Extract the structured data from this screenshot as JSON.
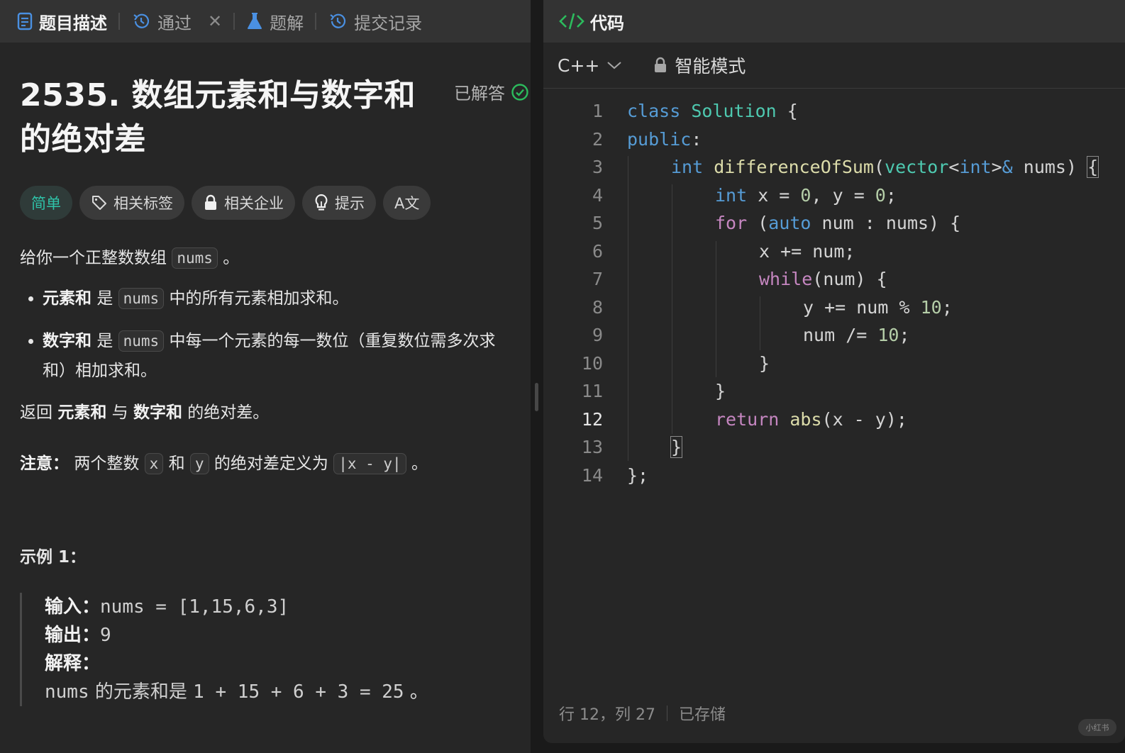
{
  "left_tabs": [
    {
      "label": "题目描述",
      "icon": "description-icon"
    },
    {
      "label": "通过",
      "icon": "history-icon"
    },
    {
      "label": "题解",
      "icon": "flask-icon"
    },
    {
      "label": "提交记录",
      "icon": "history-icon"
    }
  ],
  "problem": {
    "title_line1": "2535. 数组元素和与数字和",
    "title_line2": "的绝对差",
    "solved_label": "已解答",
    "tags": [
      "简单",
      "相关标签",
      "相关企业",
      "提示",
      "A文"
    ],
    "intro": {
      "pre": "给你一个正整数数组",
      "code": "nums",
      "post": "。"
    },
    "bullets": [
      {
        "bold": "元素和",
        "mid": "是",
        "code": "nums",
        "rest": "中的所有元素相加求和。"
      },
      {
        "bold": "数字和",
        "mid": "是",
        "code": "nums",
        "rest": "中每一个元素的每一数位（重复数位需多次求和）相加求和。"
      }
    ],
    "return_line": {
      "pre": "返回",
      "b1": "元素和",
      "mid": "与",
      "b2": "数字和",
      "post": "的绝对差。"
    },
    "note": {
      "label": "注意：",
      "t1": "两个整数",
      "x": "x",
      "t2": "和",
      "y": "y",
      "t3": "的绝对差定义为",
      "expr": "|x - y|",
      "t4": "。"
    },
    "example_heading": "示例 1：",
    "example": {
      "input_label": "输入：",
      "input_value": "nums = [1,15,6,3]",
      "output_label": "输出：",
      "output_value": "9",
      "explain_label": "解释：",
      "explain_line": {
        "code": "nums",
        "text": "的元素和是",
        "calc": "1 + 15 + 6 + 3 = 25",
        "end": "。"
      }
    }
  },
  "editor": {
    "header_title": "代码",
    "language": "C++",
    "mode": "智能模式",
    "line_numbers": [
      "1",
      "2",
      "3",
      "4",
      "5",
      "6",
      "7",
      "8",
      "9",
      "10",
      "11",
      "12",
      "13",
      "14"
    ],
    "status_position": "行 12，列 27",
    "status_saved": "已存储"
  },
  "watermark": "小红书",
  "colors": {
    "accent_easy": "#2fc2a8",
    "success": "#2cbb5d",
    "keyword": "#c586c0",
    "type": "#569cd6",
    "class": "#4ec9b0",
    "function": "#dcdcaa",
    "number": "#b5cea8"
  }
}
